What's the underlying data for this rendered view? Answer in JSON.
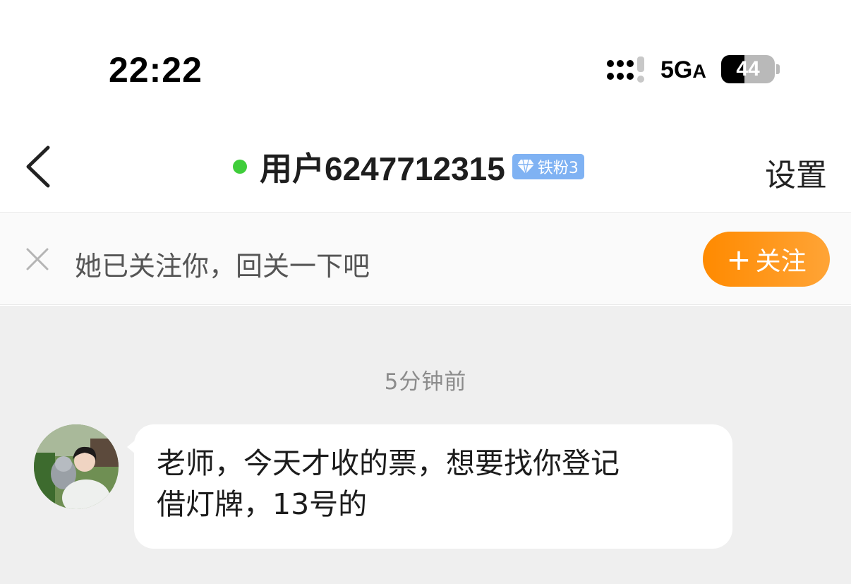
{
  "status_bar": {
    "time": "22:22",
    "network": "5G",
    "network_suffix": "A",
    "battery": "44",
    "battery_level": 0.44
  },
  "header": {
    "title": "用户6247712315",
    "online": true,
    "fan_badge": "铁粉3",
    "settings_label": "设置"
  },
  "follow_bar": {
    "text": "她已关注你，回关一下吧",
    "button_label": "关注",
    "button_plus": "+"
  },
  "chat": {
    "timestamp": "5分钟前",
    "messages": [
      {
        "text": "老师，今天才收的票，想要找你登记\n借灯牌，13号的"
      }
    ]
  },
  "colors": {
    "online": "#3fcd3a",
    "follow_button": "#ff8a00",
    "badge": "#7fb2f3"
  }
}
